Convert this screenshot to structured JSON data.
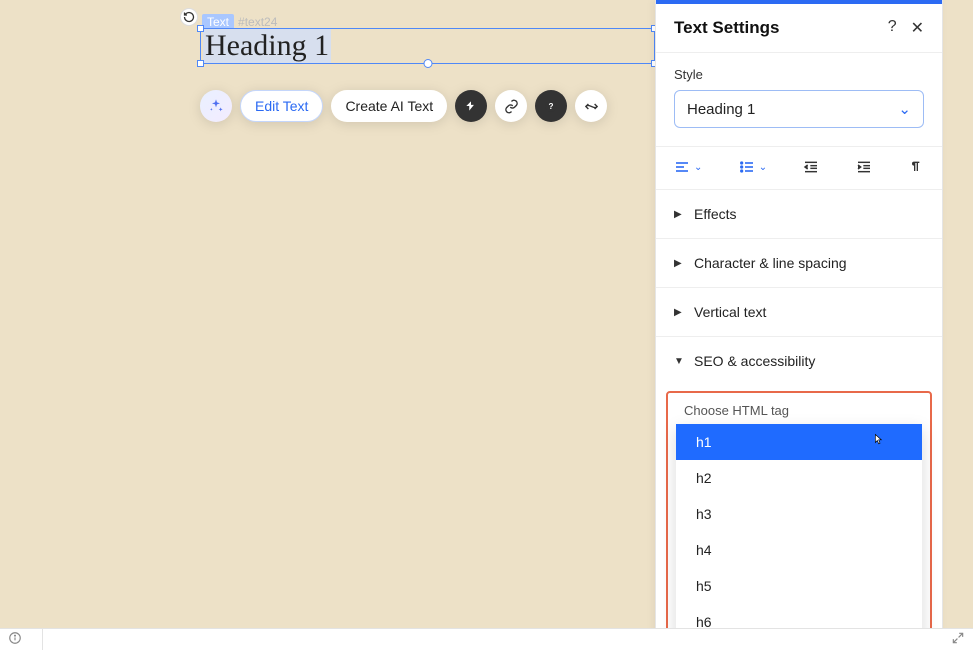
{
  "element": {
    "type_badge": "Text",
    "id": "#text24",
    "content": "Heading 1"
  },
  "toolbar": {
    "edit_text": "Edit Text",
    "create_ai_text": "Create AI Text"
  },
  "panel": {
    "title": "Text Settings",
    "style_label": "Style",
    "style_value": "Heading 1",
    "sections": {
      "effects": "Effects",
      "spacing": "Character & line spacing",
      "vertical": "Vertical text",
      "seo": "SEO & accessibility"
    },
    "seo": {
      "label": "Choose HTML tag",
      "options": [
        "h1",
        "h2",
        "h3",
        "h4",
        "h5",
        "h6"
      ],
      "selected": "h1"
    }
  }
}
